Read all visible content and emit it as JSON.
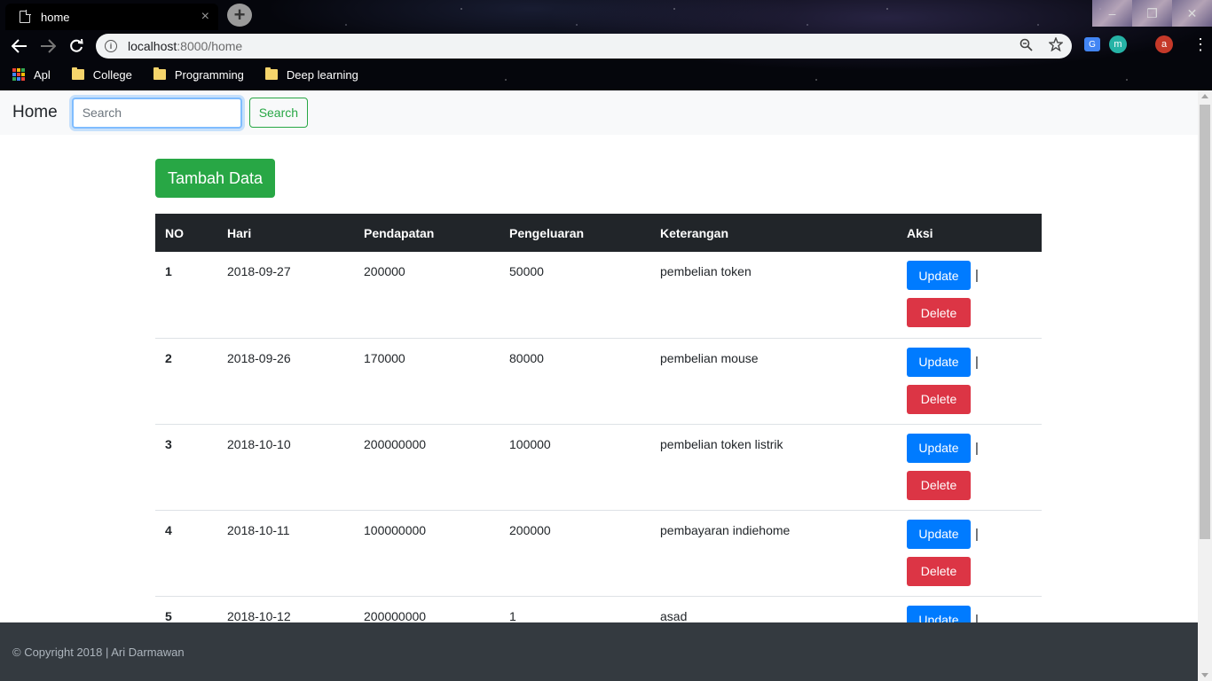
{
  "browser": {
    "tab_title": "home",
    "tab_close": "×",
    "new_tab": "+",
    "url_host": "localhost",
    "url_rest": ":8000/home",
    "window_controls": {
      "minimize": "–",
      "restore": "❐",
      "close": "✕"
    },
    "bookmarks": [
      {
        "label": "Apl",
        "icon": "apps-icon"
      },
      {
        "label": "College",
        "icon": "folder-icon"
      },
      {
        "label": "Programming",
        "icon": "folder-icon"
      },
      {
        "label": "Deep learning",
        "icon": "folder-icon"
      }
    ],
    "extensions": {
      "m_label": "m",
      "avatar_label": "a"
    }
  },
  "navbar": {
    "brand": "Home",
    "search_placeholder": "Search",
    "search_button": "Search"
  },
  "main": {
    "add_button": "Tambah Data",
    "table": {
      "headers": [
        "NO",
        "Hari",
        "Pendapatan",
        "Pengeluaran",
        "Keterangan",
        "Aksi"
      ],
      "rows": [
        {
          "no": "1",
          "hari": "2018-09-27",
          "pendapatan": "200000",
          "pengeluaran": "50000",
          "keterangan": "pembelian token"
        },
        {
          "no": "2",
          "hari": "2018-09-26",
          "pendapatan": "170000",
          "pengeluaran": "80000",
          "keterangan": "pembelian mouse"
        },
        {
          "no": "3",
          "hari": "2018-10-10",
          "pendapatan": "200000000",
          "pengeluaran": "100000",
          "keterangan": "pembelian token listrik"
        },
        {
          "no": "4",
          "hari": "2018-10-11",
          "pendapatan": "100000000",
          "pengeluaran": "200000",
          "keterangan": "pembayaran indiehome"
        },
        {
          "no": "5",
          "hari": "2018-10-12",
          "pendapatan": "200000000",
          "pengeluaran": "1",
          "keterangan": "asad"
        }
      ],
      "update_label": "Update",
      "delete_label": "Delete",
      "separator": "|"
    }
  },
  "footer": {
    "text": "© Copyright 2018 | Ari Darmawan"
  },
  "colors": {
    "success": "#28a745",
    "primary": "#007bff",
    "danger": "#dc3545",
    "dark": "#212529",
    "footer_bg": "#343a40",
    "navbar_bg": "#f8f9fa"
  }
}
